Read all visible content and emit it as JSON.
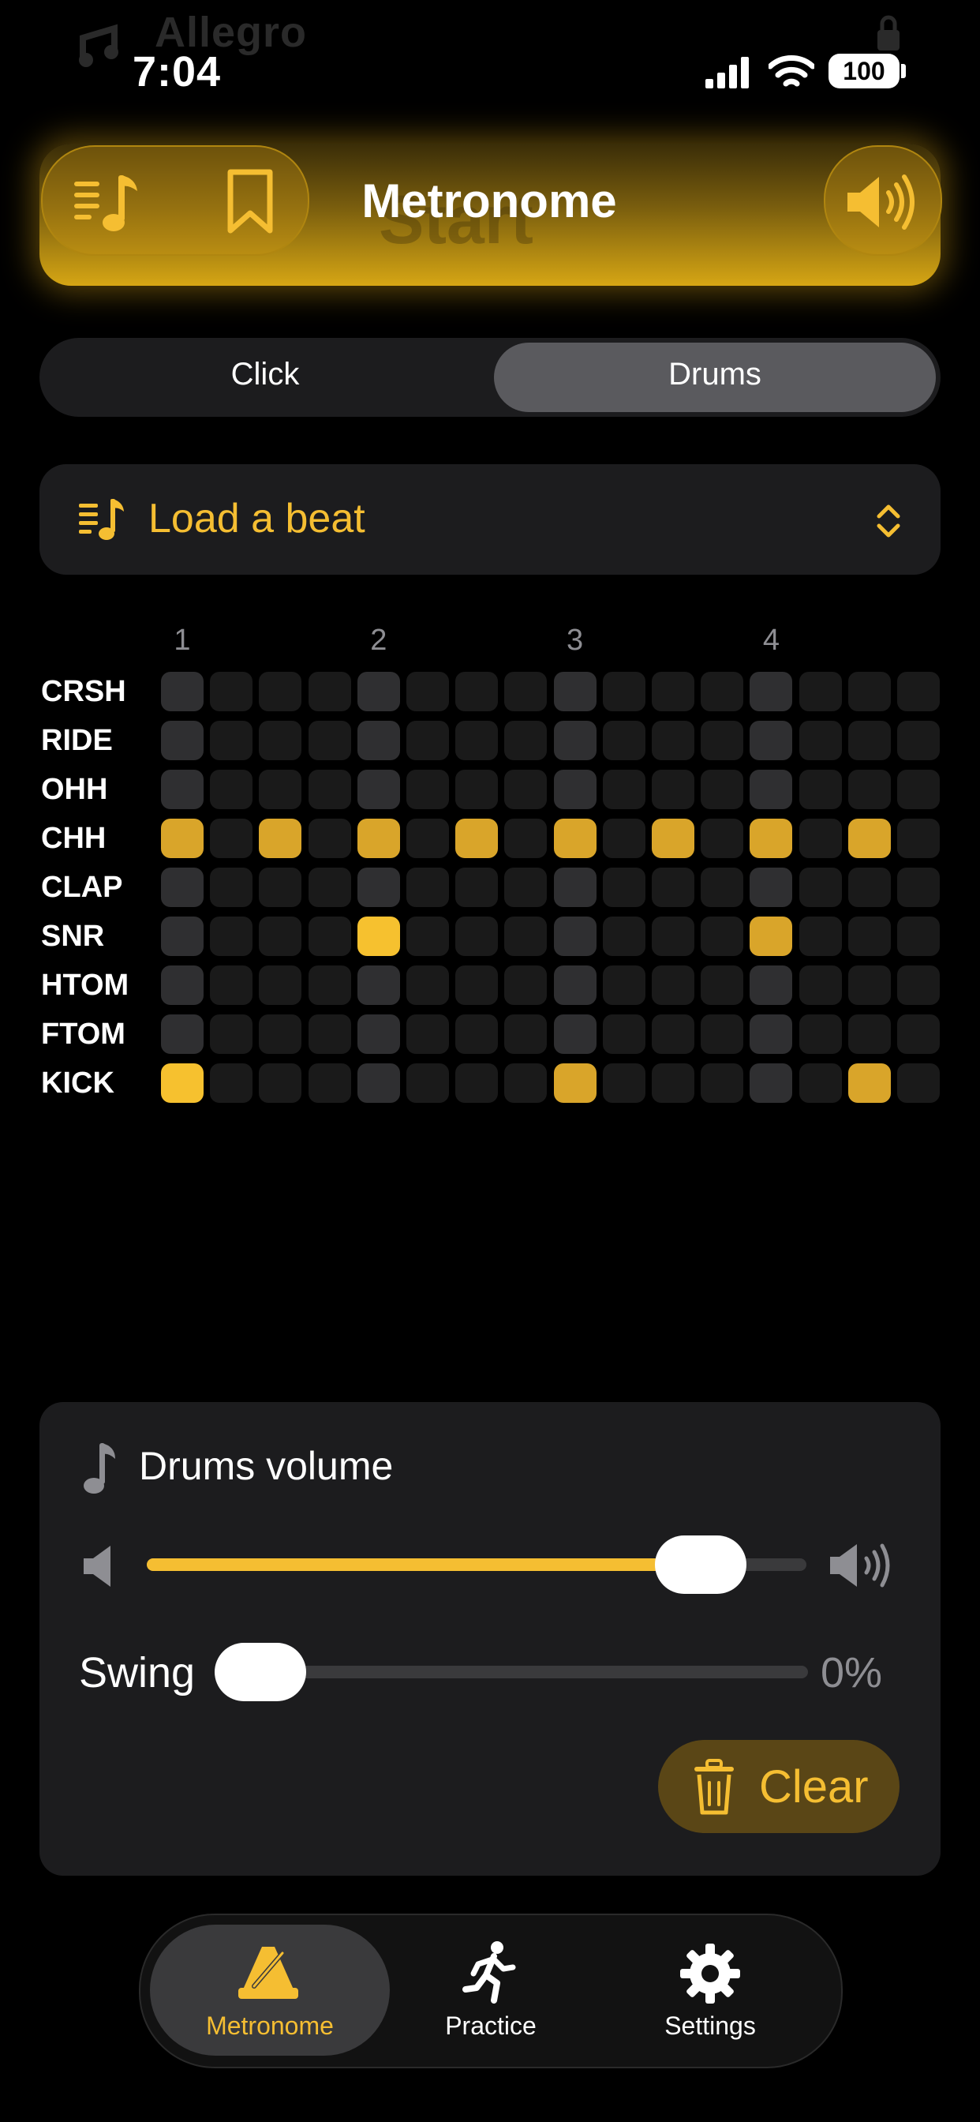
{
  "app": {
    "ghost_name": "Allegro",
    "ghost_start": "Start"
  },
  "status_bar": {
    "time": "7:04",
    "battery": "100"
  },
  "header": {
    "title": "Metronome"
  },
  "segmented": {
    "options": [
      "Click",
      "Drums"
    ],
    "selected": "Drums"
  },
  "load_beat": {
    "label": "Load a beat"
  },
  "grid": {
    "beat_numbers": [
      "1",
      "2",
      "3",
      "4"
    ],
    "rows": [
      {
        "label": "CRSH",
        "steps": []
      },
      {
        "label": "RIDE",
        "steps": []
      },
      {
        "label": "OHH",
        "steps": []
      },
      {
        "label": "CHH",
        "steps": [
          0,
          2,
          4,
          6,
          8,
          10,
          12,
          14
        ]
      },
      {
        "label": "CLAP",
        "steps": []
      },
      {
        "label": "SNR",
        "steps": [
          4,
          12
        ]
      },
      {
        "label": "HTOM",
        "steps": []
      },
      {
        "label": "FTOM",
        "steps": []
      },
      {
        "label": "KICK",
        "steps": [
          0,
          8,
          14
        ]
      }
    ]
  },
  "volume": {
    "title": "Drums volume",
    "level": 0.84
  },
  "swing": {
    "label": "Swing",
    "value": "0%",
    "level": 0
  },
  "clear": {
    "label": "Clear"
  },
  "tabs": [
    {
      "label": "Metronome",
      "active": true
    },
    {
      "label": "Practice",
      "active": false
    },
    {
      "label": "Settings",
      "active": false
    }
  ],
  "colors": {
    "accent": "#f5be32",
    "card": "#1c1c1e",
    "background": "#000000"
  }
}
